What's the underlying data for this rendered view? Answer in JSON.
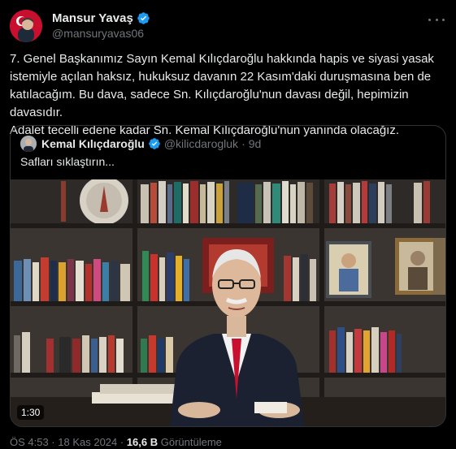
{
  "tweet": {
    "author_name": "Mansur Yavaş",
    "author_handle": "@mansuryavas06",
    "text_lines": [
      "7. Genel Başkanımız Sayın Kemal Kılıçdaroğlu hakkında hapis ve siyasi yasak",
      "istemiyle açılan haksız, hukuksuz davanın 22 Kasım'daki duruşmasına ben de",
      "katılacağım. Bu dava, sadece Sn. Kılıçdaroğlu'nun davası değil, hepimizin davasıdır.",
      "Adalet tecelli edene kadar Sn. Kemal Kılıçdaroğlu'nun yanında olacağız."
    ]
  },
  "quote": {
    "author_name": "Kemal Kılıçdaroğlu",
    "author_handle": "@kilicdarogluk",
    "separator": "·",
    "time": "9d",
    "text": "Safları sıklaştırın...",
    "video_duration": "1:30"
  },
  "meta": {
    "time_date": "ÖS 4:53 · 18 Kas 2024 · ",
    "views_count": "16,6 B",
    "views_label": " Görüntüleme"
  },
  "colors": {
    "background": "#000000",
    "text_primary": "#e7e9ea",
    "text_secondary": "#71767b",
    "verified": "#1d9bf0",
    "border": "#2f3336"
  }
}
